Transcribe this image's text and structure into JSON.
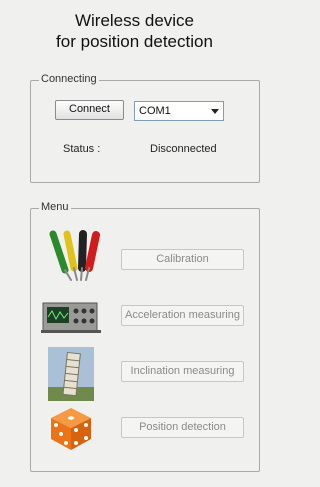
{
  "title_line1": "Wireless device",
  "title_line2": "for position detection",
  "connecting": {
    "legend": "Connecting",
    "connect_label": "Connect",
    "port_value": "COM1",
    "status_label": "Status :",
    "status_value": "Disconnected"
  },
  "menu": {
    "legend": "Menu",
    "items": [
      {
        "label": "Calibration",
        "icon": "screwdrivers-icon"
      },
      {
        "label": "Acceleration measuring",
        "icon": "oscilloscope-icon"
      },
      {
        "label": "Inclination measuring",
        "icon": "leaning-tower-icon"
      },
      {
        "label": "Position detection",
        "icon": "dice-icon"
      }
    ]
  },
  "colors": {
    "background": "#f0f0ef",
    "disabled_text": "#8a8a8a",
    "dice_orange": "#f07a1e"
  }
}
